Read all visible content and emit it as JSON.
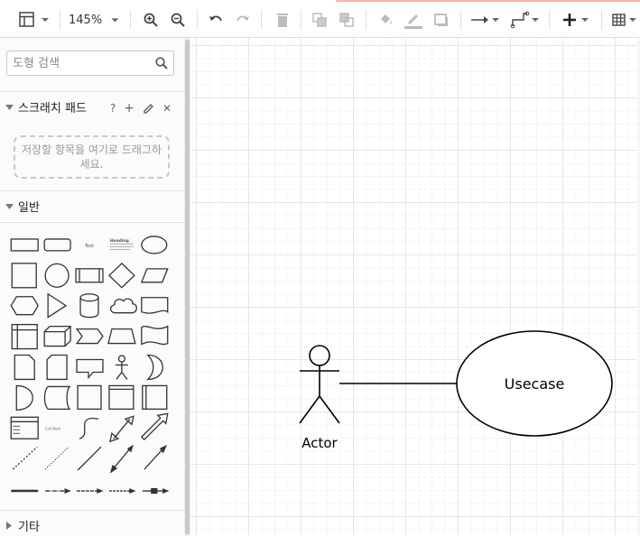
{
  "toolbar": {
    "zoom_label": "145%",
    "icons": [
      "page-view-icon",
      "zoom-in-icon",
      "zoom-out-icon",
      "undo-icon",
      "redo-icon",
      "delete-icon",
      "to-front-icon",
      "to-back-icon",
      "fill-color-icon",
      "line-color-icon",
      "shadow-icon",
      "connection-icon",
      "waypoints-icon",
      "insert-plus-icon",
      "table-icon"
    ]
  },
  "sidebar": {
    "search_placeholder": "도형 검색",
    "scratchpad": {
      "title": "스크래치 패드",
      "help": "?",
      "add": "+",
      "close": "✕",
      "drop_hint": "저장할 항목을 여기로 드래그하세요."
    },
    "general": {
      "title": "일반",
      "text_shape_label": "Text",
      "heading_label": "Heading",
      "list_item_label": "List Item"
    },
    "other": {
      "title": "기타"
    }
  },
  "diagram": {
    "actor_label": "Actor",
    "usecase_label": "Usecase"
  }
}
